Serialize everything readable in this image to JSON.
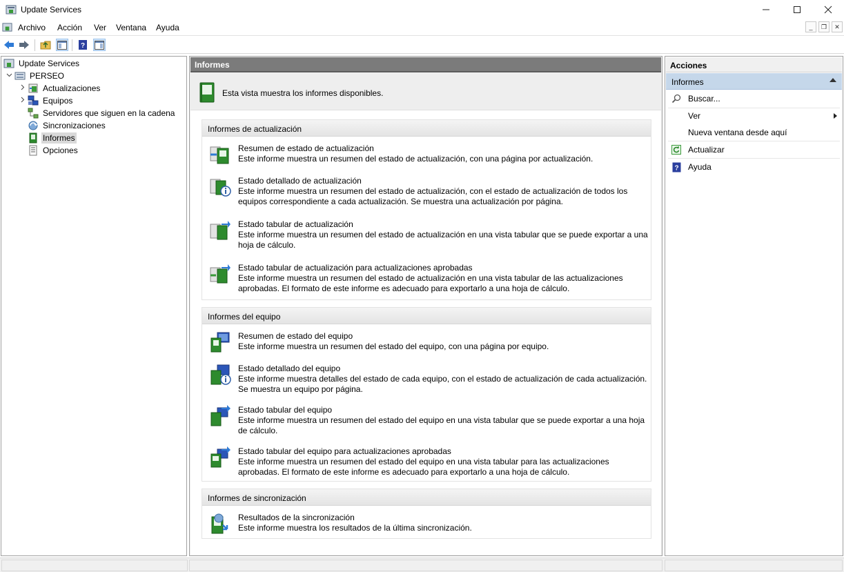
{
  "window": {
    "title": "Update Services"
  },
  "menu": [
    "Archivo",
    "Acción",
    "Ver",
    "Ventana",
    "Ayuda"
  ],
  "tree": [
    {
      "label": "Update Services",
      "icon": "server-manager-icon",
      "indent": 0,
      "expander": ""
    },
    {
      "label": "PERSEO",
      "icon": "server-icon",
      "indent": 1,
      "expander": "expanded"
    },
    {
      "label": "Actualizaciones",
      "icon": "updates-icon",
      "indent": 2,
      "expander": "collapsed"
    },
    {
      "label": "Equipos",
      "icon": "computers-icon",
      "indent": 2,
      "expander": "collapsed"
    },
    {
      "label": "Servidores que siguen en la cadena",
      "icon": "downstream-servers-icon",
      "indent": 2,
      "expander": ""
    },
    {
      "label": "Sincronizaciones",
      "icon": "sync-icon",
      "indent": 2,
      "expander": ""
    },
    {
      "label": "Informes",
      "icon": "reports-icon",
      "indent": 2,
      "expander": "",
      "selected": true
    },
    {
      "label": "Opciones",
      "icon": "options-icon",
      "indent": 2,
      "expander": ""
    }
  ],
  "main": {
    "header": "Informes",
    "intro": "Esta vista muestra los informes disponibles.",
    "sections": [
      {
        "title": "Informes de actualización",
        "reports": [
          {
            "title": "Resumen de estado de actualización",
            "desc": "Este informe muestra un resumen del estado de actualización, con una página por actualización.",
            "icon": "update-summary-report-icon"
          },
          {
            "title": "Estado detallado de actualización",
            "desc": "Este informe muestra un resumen del estado de actualización, con el estado de actualización de todos los equipos correspondiente a cada actualización. Se muestra una actualización por página.",
            "icon": "update-detailed-report-icon"
          },
          {
            "title": "Estado tabular de actualización",
            "desc": "Este informe muestra un resumen del estado de actualización en una vista tabular que se puede exportar a una hoja de cálculo.",
            "icon": "update-tabular-report-icon"
          },
          {
            "title": "Estado tabular de actualización para actualizaciones aprobadas",
            "desc": "Este informe muestra un resumen del estado de actualización en una vista tabular de las actualizaciones aprobadas. El formato de este informe es adecuado para exportarlo a una hoja de cálculo.",
            "icon": "update-tabular-approved-report-icon"
          }
        ]
      },
      {
        "title": "Informes del equipo",
        "reports": [
          {
            "title": "Resumen de estado del equipo",
            "desc": "Este informe muestra un resumen del estado del equipo, con una página por equipo.",
            "icon": "computer-summary-report-icon"
          },
          {
            "title": "Estado detallado del equipo",
            "desc": "Este informe muestra detalles del estado de cada equipo, con el estado de actualización de cada actualización. Se muestra un equipo por página.",
            "icon": "computer-detailed-report-icon"
          },
          {
            "title": "Estado tabular del equipo",
            "desc": "Este informe muestra un resumen del estado del equipo en una vista tabular que se puede exportar a una hoja de cálculo.",
            "icon": "computer-tabular-report-icon"
          },
          {
            "title": "Estado tabular del equipo para actualizaciones aprobadas",
            "desc": "Este informe muestra un resumen del estado del equipo en una vista tabular para las actualizaciones aprobadas. El formato de este informe es adecuado para exportarlo a una hoja de cálculo.",
            "icon": "computer-tabular-approved-report-icon"
          }
        ]
      },
      {
        "title": "Informes de sincronización",
        "reports": [
          {
            "title": "Resultados de la sincronización",
            "desc": "Este informe muestra los resultados de la última sincronización.",
            "icon": "sync-results-report-icon"
          }
        ]
      }
    ]
  },
  "actions": {
    "header": "Acciones",
    "group": "Informes",
    "items": [
      {
        "label": "Buscar...",
        "icon": "search-icon"
      },
      {
        "label": "Ver",
        "icon": "",
        "submenu": true
      },
      {
        "label": "Nueva ventana desde aquí",
        "icon": ""
      },
      {
        "label": "Actualizar",
        "icon": "refresh-icon"
      },
      {
        "label": "Ayuda",
        "icon": "help-icon"
      }
    ]
  },
  "colors": {
    "selection": "#d9d9d9",
    "header_dark": "#7b7b7b",
    "actions_highlight": "#c5d7ea",
    "report_green": "#2e8b2e"
  }
}
